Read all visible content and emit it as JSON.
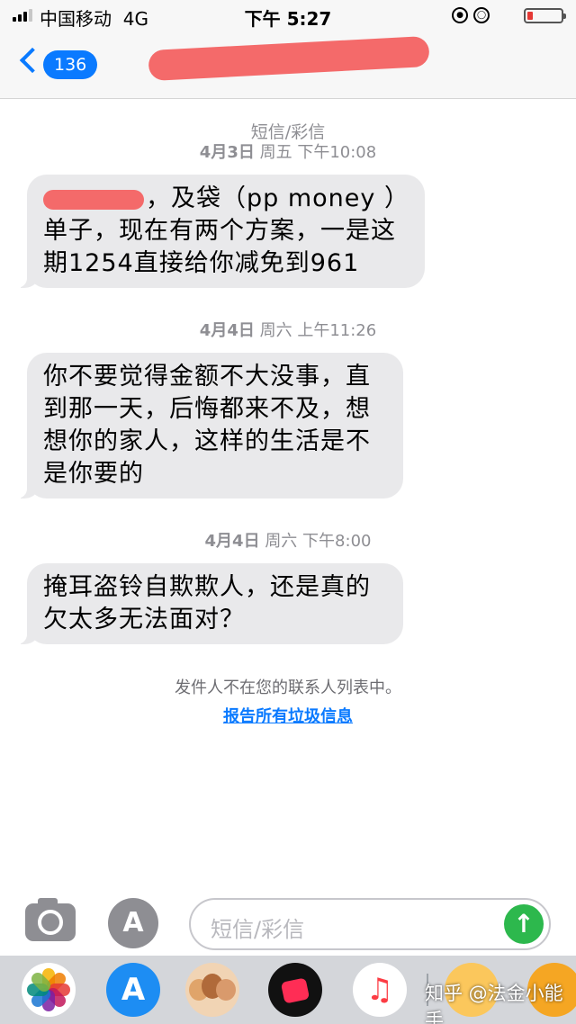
{
  "status_bar": {
    "carrier": "中国移动",
    "network": "4G",
    "time": "下午 5:27",
    "icons": [
      "signal-icon",
      "orientation-lock-icon",
      "alarm-icon",
      "battery-icon"
    ],
    "battery_level": 0.18,
    "battery_color": "#e53935"
  },
  "nav": {
    "back_count": "136",
    "accent_color": "#0a7aff"
  },
  "thread": {
    "service_label": "短信/彩信",
    "messages": [
      {
        "date": "4月3日",
        "weekday": "周五",
        "time": "下午10:08",
        "text": "，及袋（pp money ）单子，现在有两个方案，一是这期1254直接给你减免到961"
      },
      {
        "date": "4月4日",
        "weekday": "周六",
        "time": "上午11:26",
        "text": "你不要觉得金额不大没事，直到那一天，后悔都来不及，想想你的家人，这样的生活是不是你要的"
      },
      {
        "date": "4月4日",
        "weekday": "周六",
        "time": "下午8:00",
        "text": "掩耳盗铃自欺欺人，还是真的欠太多无法面对？"
      }
    ],
    "not_in_contacts": "发件人不在您的联系人列表中。",
    "report_junk": "报告所有垃圾信息"
  },
  "compose": {
    "placeholder": "短信/彩信",
    "send_color": "#2db84d"
  },
  "drawer": {
    "apps": [
      "photos-icon",
      "app-store-icon",
      "memoji-icon",
      "digital-touch-icon",
      "music-icon",
      "sticker-icon",
      "app-icon"
    ]
  },
  "watermark": "知乎 @法金小能手"
}
